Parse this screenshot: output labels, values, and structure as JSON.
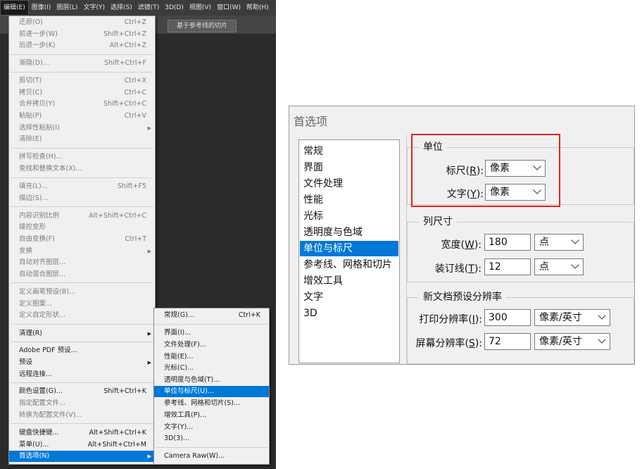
{
  "menubar": {
    "items": [
      "编辑(E)",
      "图像(I)",
      "图层(L)",
      "文字(Y)",
      "选择(S)",
      "滤镜(T)",
      "3D(D)",
      "视图(V)",
      "窗口(W)",
      "帮助(H)"
    ]
  },
  "optbar": {
    "slice_button": "基于参考线的切片"
  },
  "edit_menu": {
    "items": [
      {
        "label": "还原(O)",
        "shortcut": "Ctrl+Z"
      },
      {
        "label": "前进一步(W)",
        "shortcut": "Shift+Ctrl+Z"
      },
      {
        "label": "后退一步(K)",
        "shortcut": "Alt+Ctrl+Z"
      },
      {
        "label": "渐隐(D)...",
        "shortcut": "Shift+Ctrl+F"
      },
      {
        "label": "剪切(T)",
        "shortcut": "Ctrl+X"
      },
      {
        "label": "拷贝(C)",
        "shortcut": "Ctrl+C"
      },
      {
        "label": "合并拷贝(Y)",
        "shortcut": "Shift+Ctrl+C"
      },
      {
        "label": "粘贴(P)",
        "shortcut": "Ctrl+V"
      },
      {
        "label": "选择性粘贴(I)",
        "shortcut": ""
      },
      {
        "label": "清除(E)",
        "shortcut": ""
      },
      {
        "label": "拼写检查(H)...",
        "shortcut": ""
      },
      {
        "label": "查找和替换文本(X)...",
        "shortcut": ""
      },
      {
        "label": "填充(L)...",
        "shortcut": "Shift+F5"
      },
      {
        "label": "描边(S)...",
        "shortcut": ""
      },
      {
        "label": "内容识别比例",
        "shortcut": "Alt+Shift+Ctrl+C"
      },
      {
        "label": "操控变形",
        "shortcut": ""
      },
      {
        "label": "自由变换(F)",
        "shortcut": "Ctrl+T"
      },
      {
        "label": "变换",
        "shortcut": ""
      },
      {
        "label": "自动对齐图层...",
        "shortcut": ""
      },
      {
        "label": "自动混合图层...",
        "shortcut": ""
      },
      {
        "label": "定义画笔预设(B)...",
        "shortcut": ""
      },
      {
        "label": "定义图案...",
        "shortcut": ""
      },
      {
        "label": "定义自定形状...",
        "shortcut": ""
      },
      {
        "label": "清理(R)",
        "shortcut": ""
      },
      {
        "label": "Adobe PDF 预设...",
        "shortcut": ""
      },
      {
        "label": "预设",
        "shortcut": ""
      },
      {
        "label": "远程连接...",
        "shortcut": ""
      },
      {
        "label": "颜色设置(G)...",
        "shortcut": "Shift+Ctrl+K"
      },
      {
        "label": "指定配置文件...",
        "shortcut": ""
      },
      {
        "label": "转换为配置文件(V)...",
        "shortcut": ""
      },
      {
        "label": "键盘快捷键...",
        "shortcut": "Alt+Shift+Ctrl+K"
      },
      {
        "label": "菜单(U)...",
        "shortcut": "Alt+Shift+Ctrl+M"
      },
      {
        "label": "首选项(N)",
        "shortcut": ""
      }
    ]
  },
  "sub_menu": {
    "items": [
      {
        "label": "常规(G)...",
        "shortcut": "Ctrl+K"
      },
      {
        "label": "界面(I)...",
        "shortcut": ""
      },
      {
        "label": "文件处理(F)...",
        "shortcut": ""
      },
      {
        "label": "性能(E)...",
        "shortcut": ""
      },
      {
        "label": "光标(C)...",
        "shortcut": ""
      },
      {
        "label": "透明度与色域(T)...",
        "shortcut": ""
      },
      {
        "label": "单位与标尺(U)...",
        "shortcut": ""
      },
      {
        "label": "参考线、网格和切片(S)...",
        "shortcut": ""
      },
      {
        "label": "增效工具(P)...",
        "shortcut": ""
      },
      {
        "label": "文字(Y)...",
        "shortcut": ""
      },
      {
        "label": "3D(3)...",
        "shortcut": ""
      },
      {
        "label": "Camera Raw(W)...",
        "shortcut": ""
      }
    ]
  },
  "prefs": {
    "title": "首选项",
    "sidebar": [
      "常规",
      "界面",
      "文件处理",
      "性能",
      "光标",
      "透明度与色域",
      "单位与标尺",
      "参考线、网格和切片",
      "增效工具",
      "文字",
      "3D"
    ],
    "units": {
      "title": "单位",
      "ruler_label_pre": "标尺(",
      "ruler_key": "R",
      "ruler_label_post": "):",
      "ruler_value": "像素",
      "type_label_pre": "文字(",
      "type_key": "Y",
      "type_label_post": "):",
      "type_value": "像素"
    },
    "column": {
      "title": "列尺寸",
      "width_label_pre": "宽度(",
      "width_key": "W",
      "width_label_post": "):",
      "width_value": "180",
      "width_unit": "点",
      "gutter_label_pre": "装订线(",
      "gutter_key": "T",
      "gutter_label_post": "):",
      "gutter_value": "12",
      "gutter_unit": "点"
    },
    "newdoc": {
      "title": "新文档预设分辨率",
      "print_label_pre": "打印分辨率(",
      "print_key": "I",
      "print_label_post": "):",
      "print_value": "300",
      "print_unit": "像素/英寸",
      "screen_label_pre": "屏幕分辨率(",
      "screen_key": "S",
      "screen_label_post": "):",
      "screen_value": "72",
      "screen_unit": "像素/英寸"
    }
  },
  "colors": {
    "selection": "#0078d7",
    "highlight_box": "#e2231a"
  }
}
